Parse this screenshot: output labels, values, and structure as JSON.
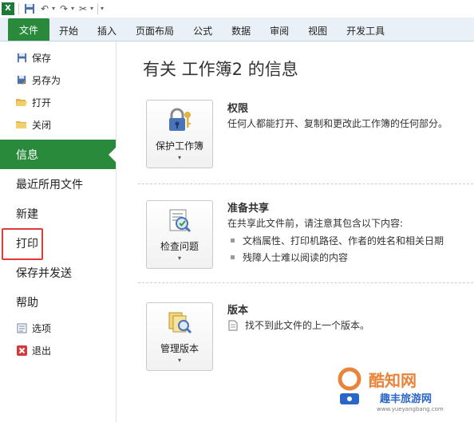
{
  "quick_access": {
    "app_icon": "excel-icon",
    "items": [
      "save-icon",
      "undo-icon",
      "redo-icon",
      "tools-icon"
    ]
  },
  "ribbon": {
    "tabs": [
      "文件",
      "开始",
      "插入",
      "页面布局",
      "公式",
      "数据",
      "审阅",
      "视图",
      "开发工具"
    ]
  },
  "backstage": {
    "small_items": [
      {
        "label": "保存",
        "icon": "save-icon"
      },
      {
        "label": "另存为",
        "icon": "save-as-icon"
      },
      {
        "label": "打开",
        "icon": "open-folder-icon"
      },
      {
        "label": "关闭",
        "icon": "close-folder-icon"
      }
    ],
    "info": "信息",
    "recent": "最近所用文件",
    "new": "新建",
    "print": "打印",
    "save_send": "保存并发送",
    "help": "帮助",
    "options": "选项",
    "exit": "退出",
    "accent": "#2a8a3b",
    "highlight_color": "#e03a3a"
  },
  "info": {
    "title": "有关 工作簿2 的信息",
    "permissions": {
      "button": "保护工作簿",
      "heading": "权限",
      "description": "任何人都能打开、复制和更改此工作簿的任何部分。"
    },
    "prepare": {
      "button": "检查问题",
      "heading": "准备共享",
      "description": "在共享此文件前，请注意其包含以下内容:",
      "bullets": [
        "文档属性、打印机路径、作者的姓名和相关日期",
        "残障人士难以阅读的内容"
      ]
    },
    "versions": {
      "button": "管理版本",
      "heading": "版本",
      "note": "找不到此文件的上一个版本。"
    }
  },
  "watermark": {
    "line1": "酷知网",
    "line2": "趣丰旅游网",
    "line3": "www.yueyangbang.com"
  }
}
